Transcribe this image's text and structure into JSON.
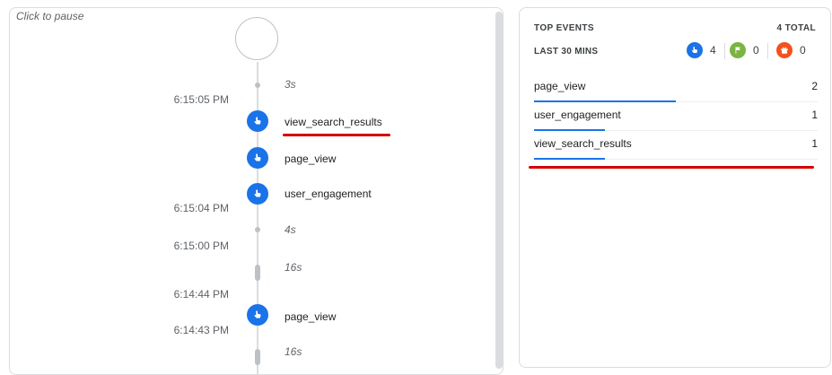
{
  "realtime": {
    "pause_label": "Click to pause",
    "times": [
      "6:15:05 PM",
      "6:15:04 PM",
      "6:15:00 PM",
      "6:14:44 PM",
      "6:14:43 PM"
    ],
    "gaps": [
      "3s",
      "4s",
      "16s",
      "16s"
    ],
    "events": [
      "view_search_results",
      "page_view",
      "user_engagement",
      "page_view"
    ]
  },
  "top_events": {
    "title": "TOP EVENTS",
    "total": "4 TOTAL",
    "period": "LAST 30 MINS",
    "counters": [
      {
        "icon": "pointer-icon",
        "color": "#1a73e8",
        "value": "4"
      },
      {
        "icon": "flag-icon",
        "color": "#7cb342",
        "value": "0"
      },
      {
        "icon": "gift-icon",
        "color": "#f4511e",
        "value": "0"
      }
    ],
    "rows": [
      {
        "name": "page_view",
        "count": "2",
        "share": 0.5
      },
      {
        "name": "user_engagement",
        "count": "1",
        "share": 0.25
      },
      {
        "name": "view_search_results",
        "count": "1",
        "share": 0.25
      }
    ]
  }
}
